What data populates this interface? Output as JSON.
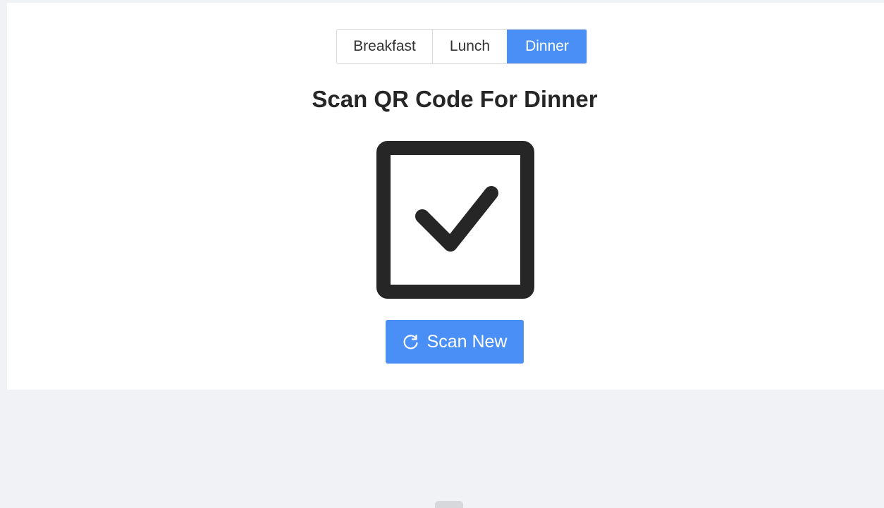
{
  "meal_tabs": {
    "items": [
      {
        "label": "Breakfast",
        "active": false
      },
      {
        "label": "Lunch",
        "active": false
      },
      {
        "label": "Dinner",
        "active": true
      }
    ]
  },
  "main": {
    "title": "Scan QR Code For Dinner",
    "status_icon": "checkbox-checked-icon"
  },
  "actions": {
    "scan_new_label": "Scan New",
    "scan_new_icon": "reload-icon"
  },
  "colors": {
    "accent": "#4a8ff5",
    "page_bg": "#f0f2f5",
    "card_bg": "#ffffff",
    "text": "#262626"
  }
}
